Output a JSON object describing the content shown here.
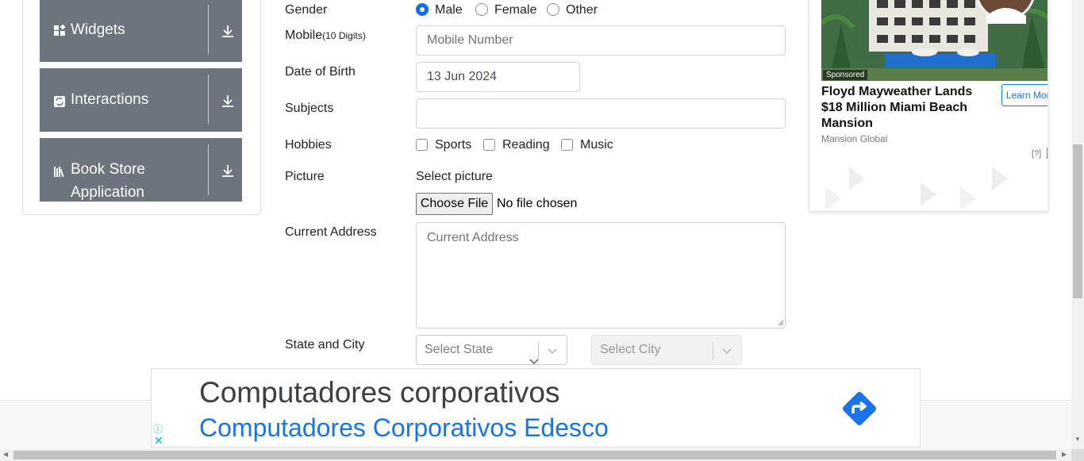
{
  "sidebar": {
    "items": [
      {
        "label": "Widgets",
        "icon": "widgets-icon"
      },
      {
        "label": "Interactions",
        "icon": "interactions-icon"
      },
      {
        "label": "Book Store Application",
        "line1": "Book Store",
        "line2": "Application",
        "icon": "book-store-icon"
      }
    ]
  },
  "form": {
    "gender": {
      "label": "Gender",
      "options": [
        "Male",
        "Female",
        "Other"
      ],
      "selected": "Male"
    },
    "mobile": {
      "label": "Mobile",
      "hint": "(10 Digits)",
      "placeholder": "Mobile Number"
    },
    "dob": {
      "label": "Date of Birth",
      "value": "13 Jun 2024"
    },
    "subjects": {
      "label": "Subjects",
      "value": ""
    },
    "hobbies": {
      "label": "Hobbies",
      "options": [
        "Sports",
        "Reading",
        "Music"
      ]
    },
    "picture": {
      "label": "Picture",
      "select_text": "Select picture",
      "button": "Choose File",
      "status": "No file chosen"
    },
    "address": {
      "label": "Current Address",
      "placeholder": "Current Address"
    },
    "state_city": {
      "label": "State and City",
      "state_placeholder": "Select State",
      "city_placeholder": "Select City"
    }
  },
  "side_ad": {
    "sponsored": "Sponsored",
    "headline": "Floyd Mayweather Lands $18 Million Miami Beach Mansion",
    "source": "Mansion Global",
    "button": "Learn More",
    "help": "[?]"
  },
  "banner_ad": {
    "title": "Computadores corporativos",
    "subtitle": "Computadores Corporativos Edesco",
    "info": "ⓘ",
    "close": "✕"
  }
}
